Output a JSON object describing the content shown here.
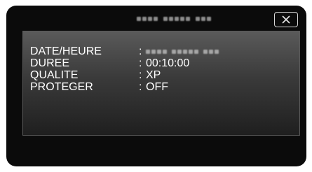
{
  "header": {
    "close_label": "Close"
  },
  "info": {
    "rows": [
      {
        "label": "DATE/HEURE",
        "separator": ":",
        "value": ""
      },
      {
        "label": "DUREE",
        "separator": ":",
        "value": "00:10:00"
      },
      {
        "label": "QUALITE",
        "separator": ":",
        "value": "XP"
      },
      {
        "label": "PROTEGER",
        "separator": ":",
        "value": "OFF"
      }
    ]
  },
  "colors": {
    "screen_bg": "#0b0b0b",
    "panel_top": "#5a5a5a",
    "panel_bottom": "#1f1f1f",
    "text": "#ffffff"
  }
}
